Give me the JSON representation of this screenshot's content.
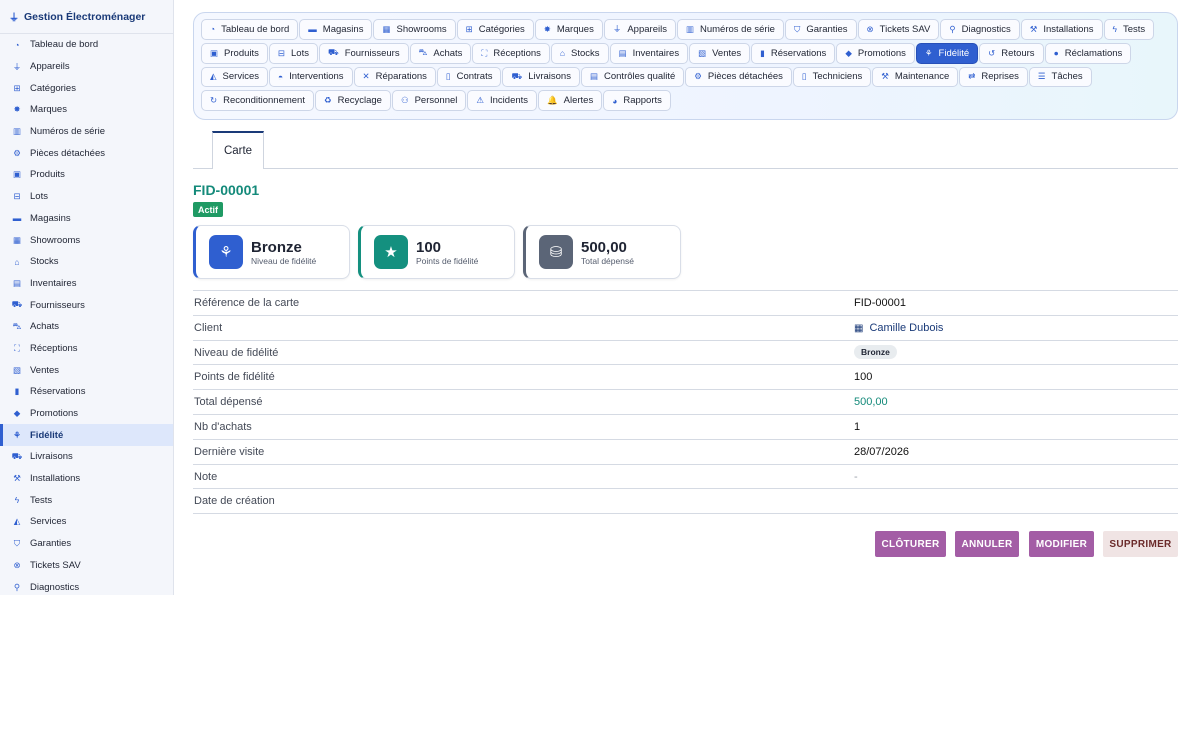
{
  "app": {
    "title": "Gestion Électroménager",
    "icon": "plug-icon"
  },
  "sidebar": {
    "items": [
      {
        "label": "Tableau de bord",
        "icon": "dashboard-icon",
        "glyph": "◔"
      },
      {
        "label": "Appareils",
        "icon": "plug-icon",
        "glyph": "⏚"
      },
      {
        "label": "Catégories",
        "icon": "sitemap-icon",
        "glyph": "⊞"
      },
      {
        "label": "Marques",
        "icon": "badge-icon",
        "glyph": "✸"
      },
      {
        "label": "Numéros de série",
        "icon": "barcode-icon",
        "glyph": "▥"
      },
      {
        "label": "Pièces détachées",
        "icon": "cog-icon",
        "glyph": "⚙"
      },
      {
        "label": "Produits",
        "icon": "box-icon",
        "glyph": "▣"
      },
      {
        "label": "Lots",
        "icon": "boxes-icon",
        "glyph": "⊟"
      },
      {
        "label": "Magasins",
        "icon": "store-icon",
        "glyph": "▬"
      },
      {
        "label": "Showrooms",
        "icon": "grid-icon",
        "glyph": "▦"
      },
      {
        "label": "Stocks",
        "icon": "warehouse-icon",
        "glyph": "⌂"
      },
      {
        "label": "Inventaires",
        "icon": "clipboard-check-icon",
        "glyph": "▤"
      },
      {
        "label": "Fournisseurs",
        "icon": "truck-icon",
        "glyph": "⛟"
      },
      {
        "label": "Achats",
        "icon": "cart-icon",
        "glyph": "⛍"
      },
      {
        "label": "Réceptions",
        "icon": "dolly-icon",
        "glyph": "⛶"
      },
      {
        "label": "Ventes",
        "icon": "cash-register-icon",
        "glyph": "▧"
      },
      {
        "label": "Réservations",
        "icon": "bookmark-icon",
        "glyph": "▮"
      },
      {
        "label": "Promotions",
        "icon": "tags-icon",
        "glyph": "◆"
      },
      {
        "label": "Fidélité",
        "icon": "award-icon",
        "glyph": "⚘",
        "active": true
      },
      {
        "label": "Livraisons",
        "icon": "truck-fast-icon",
        "glyph": "⛟"
      },
      {
        "label": "Installations",
        "icon": "wrench-icon",
        "glyph": "⚒"
      },
      {
        "label": "Tests",
        "icon": "bolt-icon",
        "glyph": "ϟ"
      },
      {
        "label": "Services",
        "icon": "hand-holding-icon",
        "glyph": "◭"
      },
      {
        "label": "Garanties",
        "icon": "shield-icon",
        "glyph": "⛉"
      },
      {
        "label": "Tickets SAV",
        "icon": "life-ring-icon",
        "glyph": "⊗"
      },
      {
        "label": "Diagnostics",
        "icon": "search-icon",
        "glyph": "⚲"
      }
    ]
  },
  "nav": {
    "rows": [
      [
        {
          "label": "Tableau de bord",
          "icon": "dashboard-icon",
          "glyph": "◔"
        },
        {
          "label": "Magasins",
          "icon": "store-icon",
          "glyph": "▬"
        },
        {
          "label": "Showrooms",
          "icon": "grid-icon",
          "glyph": "▦"
        },
        {
          "label": "Catégories",
          "icon": "sitemap-icon",
          "glyph": "⊞"
        },
        {
          "label": "Marques",
          "icon": "badge-icon",
          "glyph": "✸"
        },
        {
          "label": "Appareils",
          "icon": "plug-icon",
          "glyph": "⏚"
        },
        {
          "label": "Numéros de série",
          "icon": "barcode-icon",
          "glyph": "▥"
        },
        {
          "label": "Garanties",
          "icon": "shield-icon",
          "glyph": "⛉"
        },
        {
          "label": "Tickets SAV",
          "icon": "life-ring-icon",
          "glyph": "⊗"
        },
        {
          "label": "Diagnostics",
          "icon": "search-icon",
          "glyph": "⚲"
        },
        {
          "label": "Installations",
          "icon": "wrench-icon",
          "glyph": "⚒"
        },
        {
          "label": "Tests",
          "icon": "bolt-icon",
          "glyph": "ϟ"
        }
      ],
      [
        {
          "label": "Produits",
          "icon": "box-icon",
          "glyph": "▣"
        },
        {
          "label": "Lots",
          "icon": "boxes-icon",
          "glyph": "⊟"
        },
        {
          "label": "Fournisseurs",
          "icon": "truck-icon",
          "glyph": "⛟"
        },
        {
          "label": "Achats",
          "icon": "cart-icon",
          "glyph": "⛍"
        },
        {
          "label": "Réceptions",
          "icon": "dolly-icon",
          "glyph": "⛶"
        },
        {
          "label": "Stocks",
          "icon": "warehouse-icon",
          "glyph": "⌂"
        },
        {
          "label": "Inventaires",
          "icon": "clipboard-check-icon",
          "glyph": "▤"
        },
        {
          "label": "Ventes",
          "icon": "cash-register-icon",
          "glyph": "▧"
        },
        {
          "label": "Réservations",
          "icon": "bookmark-icon",
          "glyph": "▮"
        },
        {
          "label": "Promotions",
          "icon": "tags-icon",
          "glyph": "◆"
        },
        {
          "label": "Fidélité",
          "icon": "award-icon",
          "glyph": "⚘",
          "active": true
        },
        {
          "label": "Retours",
          "icon": "undo-icon",
          "glyph": "↺"
        },
        {
          "label": "Réclamations",
          "icon": "comment-icon",
          "glyph": "●"
        }
      ],
      [
        {
          "label": "Services",
          "icon": "hand-holding-icon",
          "glyph": "◭"
        },
        {
          "label": "Interventions",
          "icon": "helmet-icon",
          "glyph": "◓"
        },
        {
          "label": "Réparations",
          "icon": "tools-icon",
          "glyph": "✕"
        },
        {
          "label": "Contrats",
          "icon": "file-contract-icon",
          "glyph": "▯"
        },
        {
          "label": "Livraisons",
          "icon": "truck-fast-icon",
          "glyph": "⛟"
        },
        {
          "label": "Contrôles qualité",
          "icon": "clipboard-list-icon",
          "glyph": "▤"
        },
        {
          "label": "Pièces détachées",
          "icon": "cog-icon",
          "glyph": "⚙"
        },
        {
          "label": "Techniciens",
          "icon": "id-badge-icon",
          "glyph": "▯"
        },
        {
          "label": "Maintenance",
          "icon": "hammer-icon",
          "glyph": "⚒"
        },
        {
          "label": "Reprises",
          "icon": "exchange-icon",
          "glyph": "⇄"
        },
        {
          "label": "Tâches",
          "icon": "list-check-icon",
          "glyph": "☰"
        }
      ],
      [
        {
          "label": "Reconditionnement",
          "icon": "rotate-icon",
          "glyph": "↻"
        },
        {
          "label": "Recyclage",
          "icon": "recycle-icon",
          "glyph": "♻"
        },
        {
          "label": "Personnel",
          "icon": "users-icon",
          "glyph": "⚇"
        },
        {
          "label": "Incidents",
          "icon": "warning-icon",
          "glyph": "⚠"
        },
        {
          "label": "Alertes",
          "icon": "bell-icon",
          "glyph": "🔔"
        },
        {
          "label": "Rapports",
          "icon": "pie-chart-icon",
          "glyph": "◕"
        }
      ]
    ]
  },
  "tabs": [
    {
      "label": "Carte"
    }
  ],
  "record": {
    "title": "FID-00001",
    "status": "Actif",
    "status_color": "#1f9a64"
  },
  "cards": [
    {
      "value": "Bronze",
      "label": "Niveau de fidélité",
      "icon": "award-icon",
      "glyph": "⚘",
      "color": "#2f5fd0"
    },
    {
      "value": "100",
      "label": "Points de fidélité",
      "icon": "star-icon",
      "glyph": "★",
      "color": "#14907f"
    },
    {
      "value": "500,00",
      "label": "Total dépensé",
      "icon": "coins-icon",
      "glyph": "⛁",
      "color": "#5b6577"
    }
  ],
  "details": [
    {
      "key": "Référence de la carte",
      "value": "FID-00001",
      "style": ""
    },
    {
      "key": "Client",
      "value": "Camille Dubois",
      "style": "link",
      "icon": "building-icon"
    },
    {
      "key": "Niveau de fidélité",
      "value": "Bronze",
      "style": "pill"
    },
    {
      "key": "Points de fidélité",
      "value": "100",
      "style": ""
    },
    {
      "key": "Total dépensé",
      "value": "500,00",
      "style": "teal"
    },
    {
      "key": "Nb d'achats",
      "value": "1",
      "style": ""
    },
    {
      "key": "Dernière visite",
      "value": "28/07/2026",
      "style": ""
    },
    {
      "key": "Note",
      "value": "-",
      "style": "muted"
    },
    {
      "key": "Date de création",
      "value": "",
      "style": ""
    }
  ],
  "actions": [
    {
      "label": "CLÔTURER",
      "color": "#a35da5",
      "text": "#ffffff"
    },
    {
      "label": "ANNULER",
      "color": "#a35da5",
      "text": "#ffffff"
    },
    {
      "label": "MODIFIER",
      "color": "#a35da5",
      "text": "#ffffff"
    },
    {
      "label": "SUPPRIMER",
      "color": "#f0e4e4",
      "text": "#6b2a2a"
    }
  ]
}
